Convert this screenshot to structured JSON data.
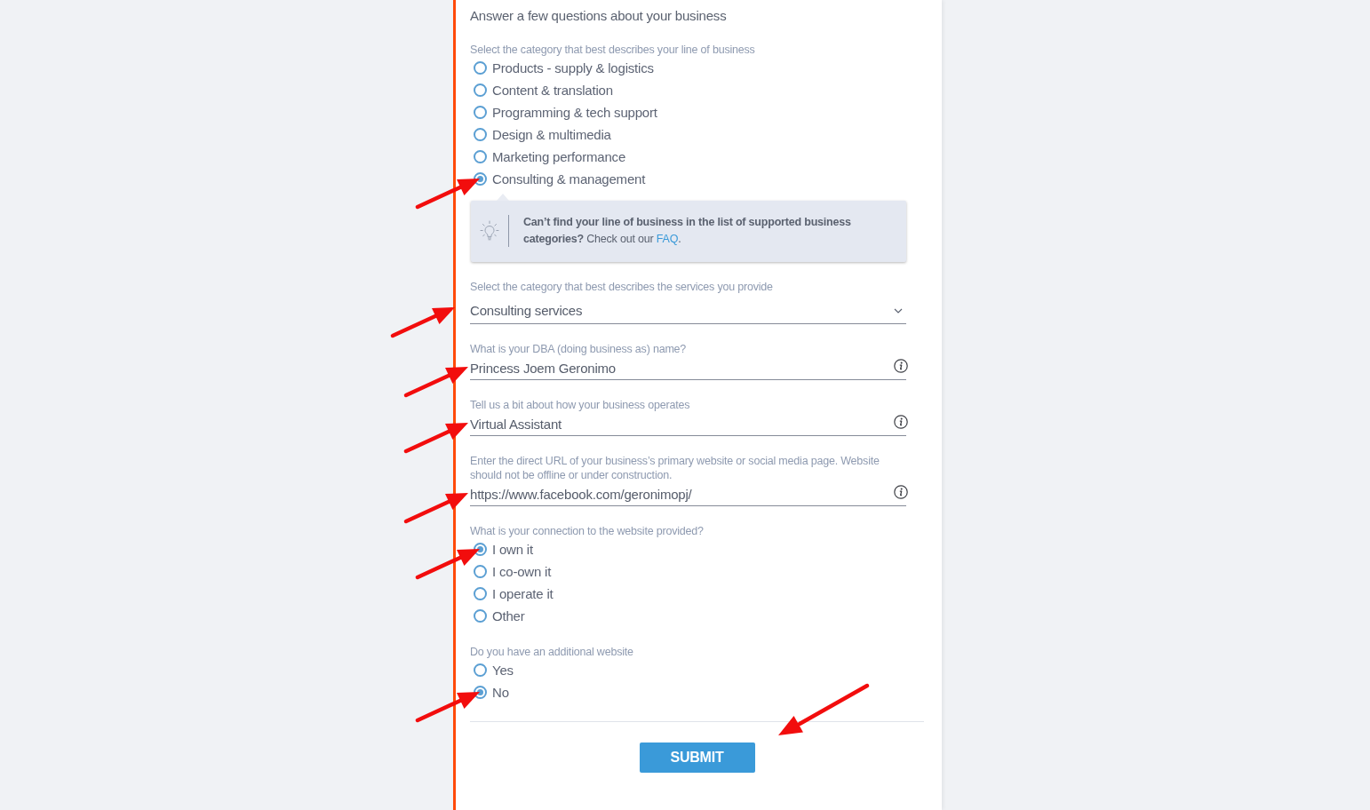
{
  "form": {
    "heading": "Answer a few questions about your business",
    "sections": [
      {
        "kind": "radio_group",
        "label": "Select the category that best describes your line of business",
        "options": [
          {
            "label": "Products - supply & logistics",
            "selected": false,
            "annotation_arrow": false
          },
          {
            "label": "Content & translation",
            "selected": false,
            "annotation_arrow": false
          },
          {
            "label": "Programming & tech support",
            "selected": false,
            "annotation_arrow": false
          },
          {
            "label": "Design & multimedia",
            "selected": false,
            "annotation_arrow": false
          },
          {
            "label": "Marketing performance",
            "selected": false,
            "annotation_arrow": false
          },
          {
            "label": "Consulting & management",
            "selected": true,
            "annotation_arrow": true
          }
        ]
      },
      {
        "kind": "tip",
        "text": "**Can’t find your line of business in the list of supported business categories?** Check out our ",
        "link": "FAQ",
        "text_end": "."
      },
      {
        "kind": "select",
        "label": "Select the category that best describes the services you provide",
        "value": "Consulting services",
        "annotation_arrow": true
      },
      {
        "kind": "text",
        "label": "What is your DBA (doing business as) name?",
        "value": "Princess Joem Geronimo",
        "annotation_arrow": true
      },
      {
        "kind": "text",
        "label": "Tell us a bit about how your business operates",
        "value": "Virtual Assistant",
        "annotation_arrow": true
      },
      {
        "kind": "text",
        "label": "Enter the direct URL of your business’s primary website or social media page. Website should not be offline or under construction.",
        "value": "https://www.facebook.com/geronimopj/",
        "annotation_arrow": true
      },
      {
        "kind": "radio_group",
        "label": "What is your connection to the website provided?",
        "options": [
          {
            "label": "I own it",
            "selected": true,
            "annotation_arrow": true
          },
          {
            "label": "I co-own it",
            "selected": false,
            "annotation_arrow": false
          },
          {
            "label": "I operate it",
            "selected": false,
            "annotation_arrow": false
          },
          {
            "label": "Other",
            "selected": false,
            "annotation_arrow": false
          }
        ]
      },
      {
        "kind": "radio_group",
        "label": "Do you have an additional website",
        "options": [
          {
            "label": "Yes",
            "selected": false,
            "annotation_arrow": false
          },
          {
            "label": "No",
            "selected": true,
            "annotation_arrow": true
          }
        ]
      }
    ],
    "submit": {
      "label": "SUBMIT",
      "annotation_arrow": true
    }
  }
}
